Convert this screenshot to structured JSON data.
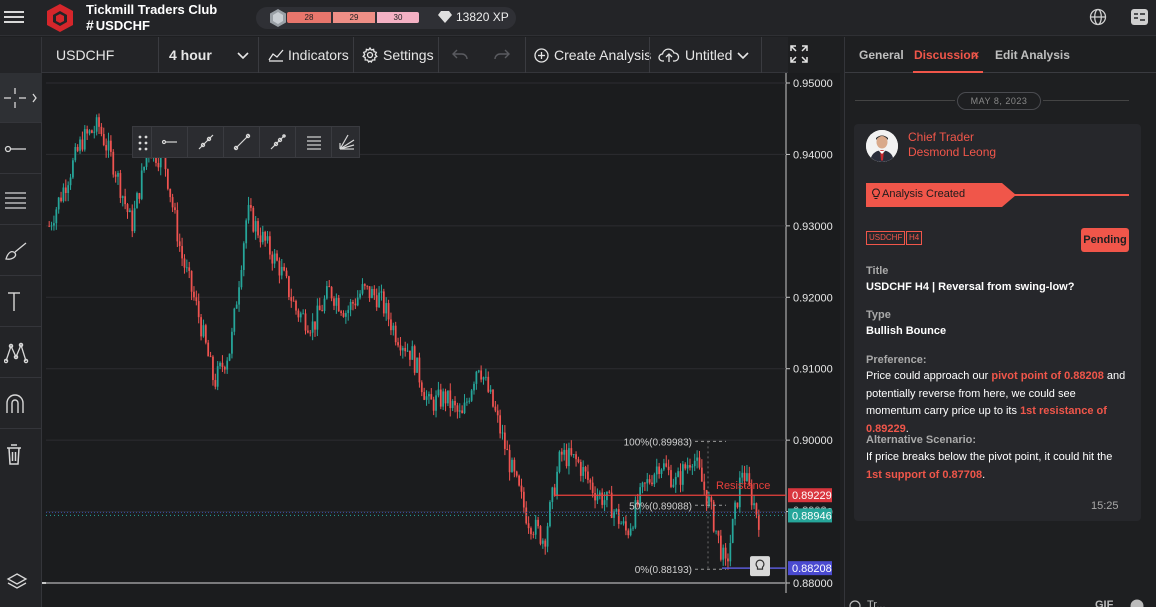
{
  "app": {
    "club_name": "Tickmill Traders Club",
    "channel": "USDCHF",
    "xp_levels": [
      "28",
      "29",
      "30"
    ],
    "xp_value": "13820 XP"
  },
  "toolbar": {
    "symbol": "USDCHF",
    "interval": "4 hour",
    "indicators_label": "Indicators",
    "settings_label": "Settings",
    "create_analysis_label": "Create Analysis",
    "layout_name": "Untitled"
  },
  "left_tools": [
    "crosshair-icon",
    "horizontal-ray-icon",
    "fib-levels-icon",
    "brush-icon",
    "text-icon",
    "pattern-icon",
    "magnet-icon",
    "trash-icon",
    "layers-icon"
  ],
  "chart_data": {
    "type": "candlestick",
    "symbol": "USDCHF",
    "interval": "4 hour",
    "ylim": [
      0.88,
      0.95
    ],
    "y_ticks": [
      "0.95000",
      "0.94000",
      "0.93000",
      "0.92000",
      "0.91000",
      "0.90000",
      "0.89000",
      "0.88000"
    ],
    "price_path": [
      0.93,
      0.936,
      0.942,
      0.944,
      0.938,
      0.93,
      0.941,
      0.939,
      0.926,
      0.918,
      0.908,
      0.913,
      0.932,
      0.928,
      0.924,
      0.918,
      0.916,
      0.921,
      0.918,
      0.921,
      0.92,
      0.915,
      0.912,
      0.905,
      0.906,
      0.903,
      0.911,
      0.904,
      0.896,
      0.889,
      0.886,
      0.898,
      0.897,
      0.893,
      0.891,
      0.887,
      0.893,
      0.897,
      0.894,
      0.898,
      0.891,
      0.882,
      0.896,
      0.889
    ],
    "fib_levels": [
      {
        "label": "100%(0.89983)",
        "price": 0.89983
      },
      {
        "label": "50%(0.89088)",
        "price": 0.89088
      },
      {
        "label": "0%(0.88193)",
        "price": 0.88193
      }
    ],
    "lines": [
      {
        "label": "Resistance",
        "price": 0.89229,
        "color": "#e8403c"
      },
      {
        "label": "",
        "price": 0.88208,
        "color": "#5a5ad6"
      }
    ],
    "price_labels": [
      {
        "text": "0.89229",
        "price": 0.89229,
        "color": "#d9363e"
      },
      {
        "text": "0.88946",
        "price": 0.88946,
        "color": "#26a69a"
      },
      {
        "text": "0.88208",
        "price": 0.88208,
        "color": "#4a4ad0"
      }
    ],
    "partial_label": "0.8902"
  },
  "panel": {
    "tabs": [
      "General",
      "Discussion",
      "Edit Analysis"
    ],
    "active_tab": "Discussion",
    "date": "MAY 8, 2023",
    "author_role": "Chief Trader",
    "author_name": "Desmond Leong",
    "banner": "Analysis Created",
    "tags": [
      "USDCHF",
      "H4"
    ],
    "status": "Pending",
    "title_label": "Title",
    "title_value": "USDCHF H4 | Reversal from swing-low?",
    "type_label": "Type",
    "type_value": "Bullish Bounce",
    "preference_label": "Preference:",
    "preference_parts": [
      "Price could approach our ",
      "pivot point of 0.88208",
      " and potentially reverse from here, we could see momentum carry price up to its ",
      "1st resistance of 0.89229",
      "."
    ],
    "alt_label": "Alternative Scenario:",
    "alt_parts": [
      "If price breaks below the pivot point, it could hit the ",
      "1st support of 0.87708",
      "."
    ],
    "time": "15:25",
    "bottom_left": "Tr...",
    "bottom_right": "GIF"
  },
  "colors": {
    "accent": "#f0564a",
    "bull": "#26a69a",
    "bear": "#ef5350",
    "bg": "#1e1f21"
  }
}
